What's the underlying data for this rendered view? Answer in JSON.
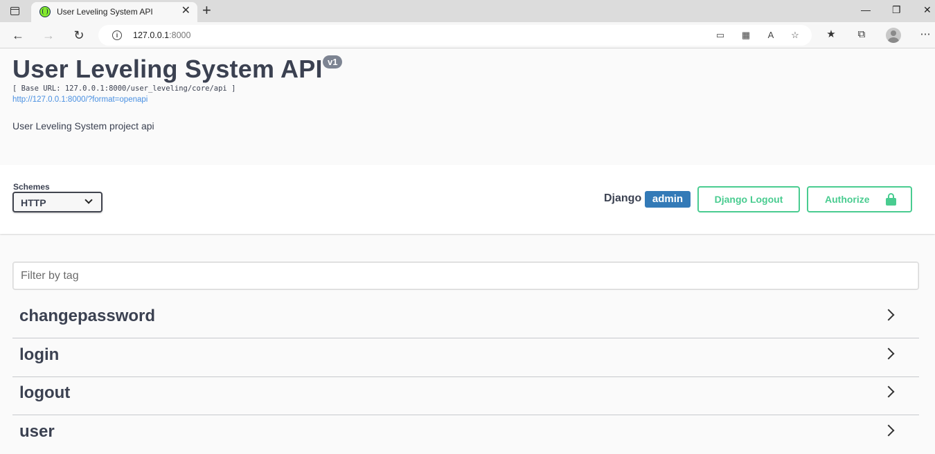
{
  "browser": {
    "tab_title": "User Leveling System API",
    "tab_close": "✕",
    "new_tab": "+",
    "url_host": "127.0.0.1",
    "url_port": ":8000",
    "window_controls": [
      "—",
      "❐",
      "✕"
    ]
  },
  "info": {
    "title": "User Leveling System API",
    "version": "v1",
    "base_url": "[ Base URL: 127.0.0.1:8000/user_leveling/core/api ]",
    "spec_link": "http://127.0.0.1:8000/?format=openapi",
    "description": "User Leveling System project api"
  },
  "schemes": {
    "label": "Schemes",
    "selected": "HTTP"
  },
  "auth": {
    "django_label": "Django",
    "user": "admin",
    "logout_label": "Django Logout",
    "authorize_label": "Authorize"
  },
  "filter": {
    "placeholder": "Filter by tag"
  },
  "tags": [
    {
      "name": "changepassword"
    },
    {
      "name": "login"
    },
    {
      "name": "logout"
    },
    {
      "name": "user"
    }
  ],
  "colors": {
    "accent_green": "#49cc90",
    "admin_blue": "#337ab7",
    "text": "#3b4151",
    "link": "#4990e2"
  }
}
